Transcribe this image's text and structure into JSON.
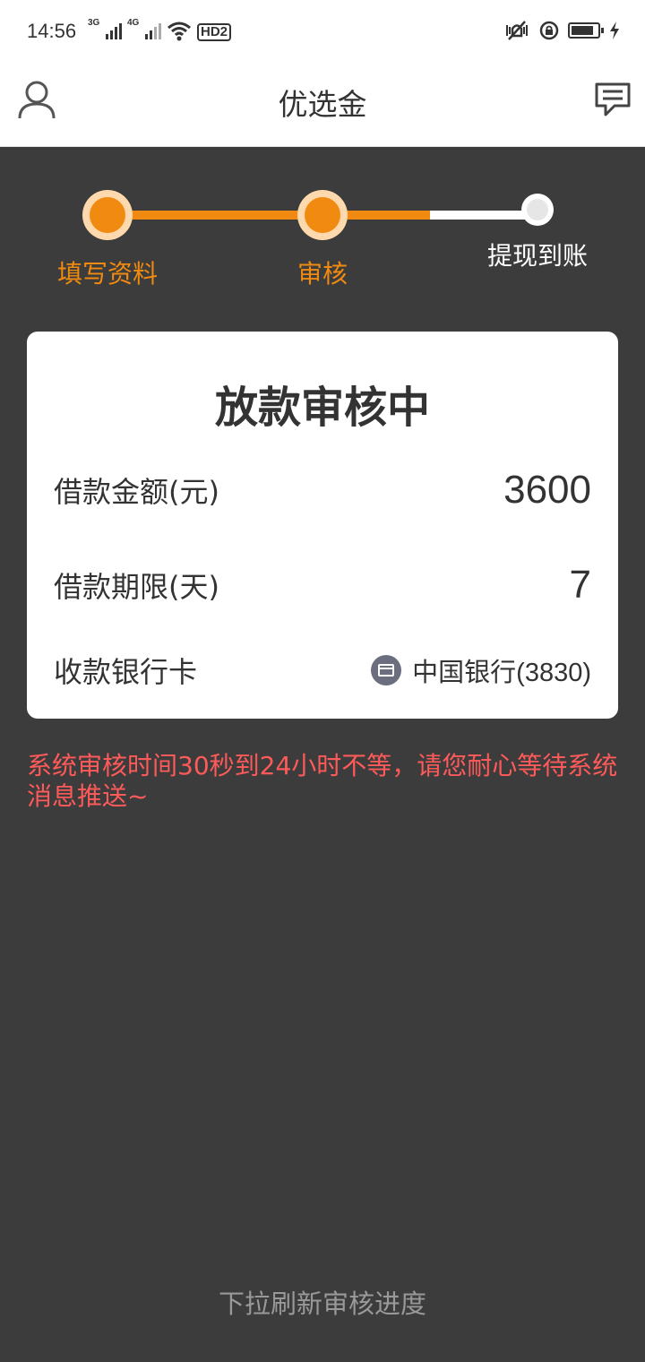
{
  "status_bar": {
    "time": "14:56",
    "net1": "3G",
    "net2": "4G",
    "hd": "HD2",
    "icons": [
      "signal-3g-icon",
      "signal-4g-icon",
      "wifi-icon",
      "hd-voice-icon",
      "vibrate-icon",
      "lock-rotation-icon",
      "battery-icon",
      "charging-icon"
    ]
  },
  "header": {
    "title": "优选金",
    "left_icon": "user-profile-icon",
    "right_icon": "message-icon"
  },
  "steps": [
    {
      "label": "填写资料",
      "state": "done"
    },
    {
      "label": "审核",
      "state": "done"
    },
    {
      "label": "提现到账",
      "state": "todo"
    }
  ],
  "colors": {
    "accent": "#f08a10",
    "accent_light": "#ffd9ae",
    "background": "#3c3c3c",
    "notice": "#ff5a5a",
    "hint": "#999999"
  },
  "card": {
    "title": "放款审核中",
    "rows": [
      {
        "label": "借款金额(元)",
        "value": "3600"
      },
      {
        "label": "借款期限(天)",
        "value": "7"
      },
      {
        "label": "收款银行卡",
        "value": "中国银行(3830)",
        "icon": "bank-card-icon"
      }
    ]
  },
  "notice": "系统审核时间30秒到24小时不等，请您耐心等待系统消息推送~",
  "refresh_hint": "下拉刷新审核进度"
}
